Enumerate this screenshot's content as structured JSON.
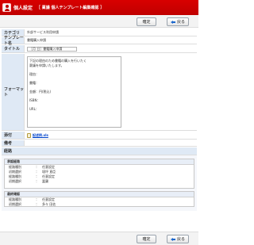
{
  "window": {
    "title": "個人設定",
    "subtitle": "［ 稟議 個人テンプレート編集確認 ］"
  },
  "toolbar": {
    "confirm_label": "確定",
    "back_label": "戻る"
  },
  "form": {
    "category_label": "カテゴリ",
    "category_value": "外部サービス利用申請",
    "template_label": "テンプレート名",
    "template_value": "書籍購入申請",
    "title_label": "タイトル",
    "title_value": "［月 日］書籍購入申請",
    "format_label": "フォーマット",
    "format_lines": [
      "下記の理由のため書籍の購入を行いたく",
      "稟議を申請いたします。",
      "",
      "理由：",
      "",
      "書籍：",
      "",
      "金額：円(税込)",
      "",
      "ISBN：",
      "",
      "URL："
    ],
    "attach_label": "添付",
    "attach_file": "記述例.xls",
    "remarks_label": "備考",
    "remarks_value": ""
  },
  "route": {
    "header": "経路",
    "approval": {
      "title": "承認経路",
      "rows": [
        {
          "key": "経路種別",
          "value": "任意設定"
        },
        {
          "key": "初期選択",
          "value": "境坪 直臣"
        },
        {
          "key": "経路種別",
          "value": "任意設定"
        },
        {
          "key": "初期選択",
          "value": "冨蘭"
        }
      ]
    },
    "final": {
      "title": "最終確認",
      "rows": [
        {
          "key": "経路種別",
          "value": "任意設定"
        },
        {
          "key": "初期選択",
          "value": "多々 田佐"
        }
      ]
    }
  },
  "colors": {
    "title_bar": "#c00000",
    "label_bg": "#dfe9f5",
    "link": "#0044cc"
  }
}
